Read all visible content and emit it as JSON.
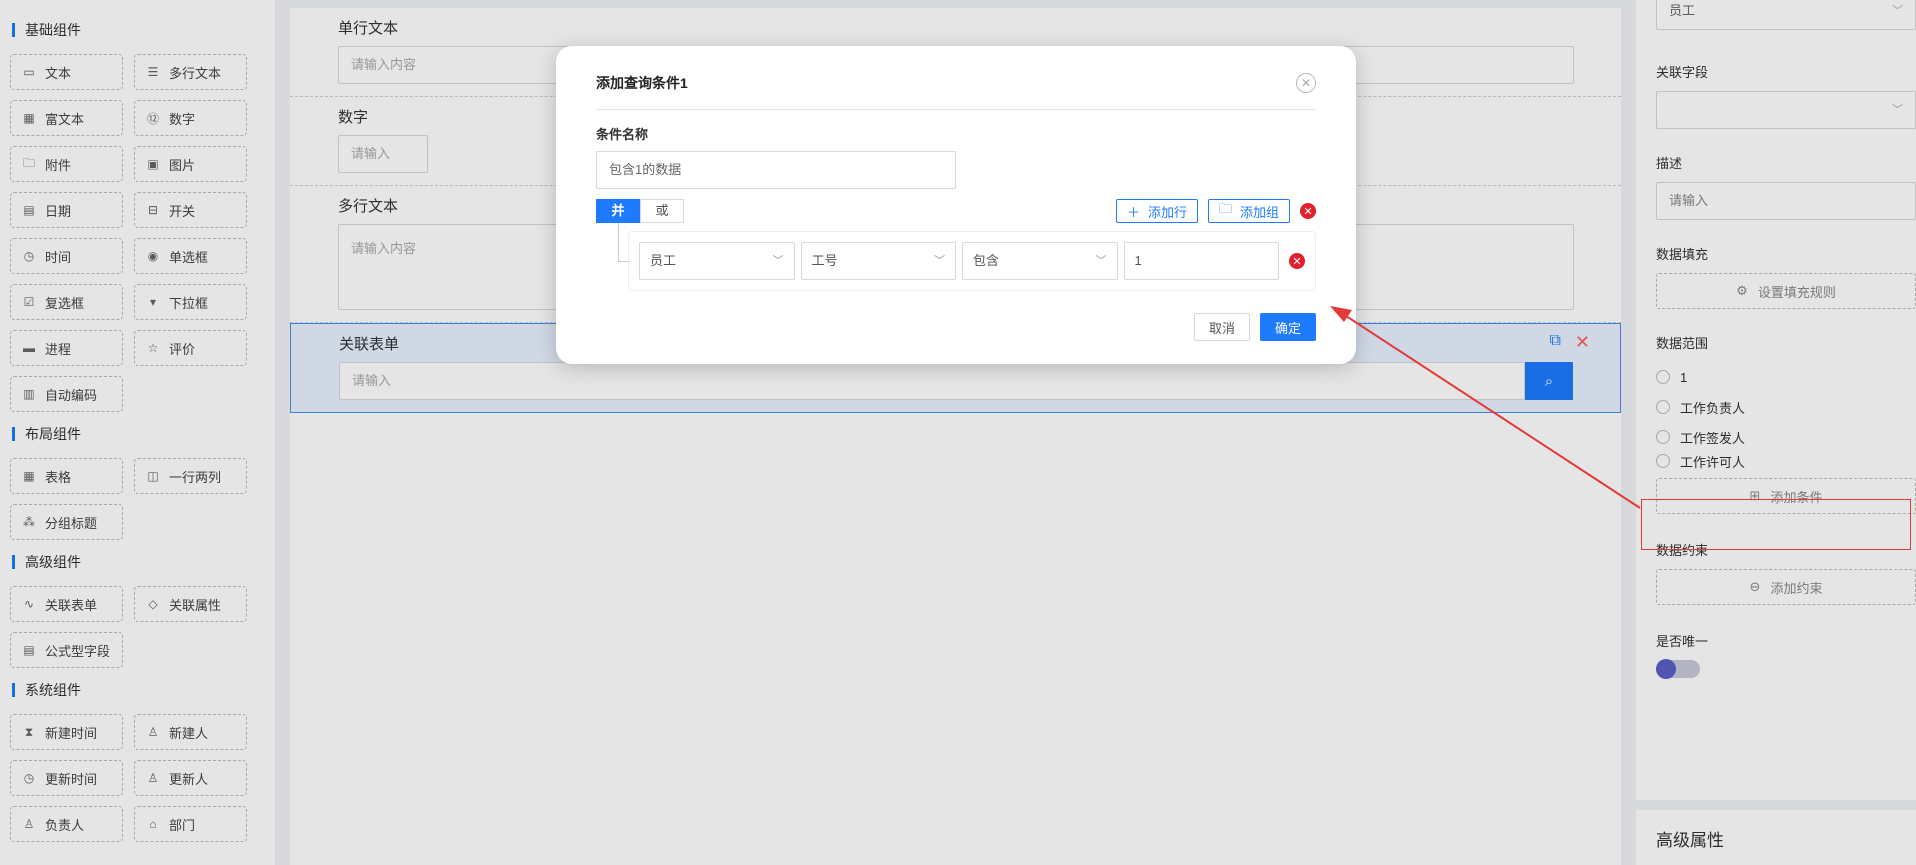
{
  "sidebar": {
    "groups": [
      {
        "title": "基础组件",
        "items": [
          {
            "label": "文本",
            "icon": "text-icon"
          },
          {
            "label": "多行文本",
            "icon": "multiline-icon"
          },
          {
            "label": "富文本",
            "icon": "richtext-icon"
          },
          {
            "label": "数字",
            "icon": "number-icon"
          },
          {
            "label": "附件",
            "icon": "folder-icon"
          },
          {
            "label": "图片",
            "icon": "image-icon"
          },
          {
            "label": "日期",
            "icon": "calendar-icon"
          },
          {
            "label": "开关",
            "icon": "switch-icon"
          },
          {
            "label": "时间",
            "icon": "clock-icon"
          },
          {
            "label": "单选框",
            "icon": "radio-icon"
          },
          {
            "label": "复选框",
            "icon": "checkbox-icon"
          },
          {
            "label": "下拉框",
            "icon": "dropdown-icon"
          },
          {
            "label": "进程",
            "icon": "progress-icon"
          },
          {
            "label": "评价",
            "icon": "star-icon"
          },
          {
            "label": "自动编码",
            "icon": "autocode-icon"
          }
        ]
      },
      {
        "title": "布局组件",
        "items": [
          {
            "label": "表格",
            "icon": "table-icon"
          },
          {
            "label": "一行两列",
            "icon": "two-column-icon"
          },
          {
            "label": "分组标题",
            "icon": "group-icon"
          }
        ]
      },
      {
        "title": "高级组件",
        "items": [
          {
            "label": "关联表单",
            "icon": "link-form-icon"
          },
          {
            "label": "关联属性",
            "icon": "tag-icon"
          },
          {
            "label": "公式型字段",
            "icon": "formula-icon"
          }
        ]
      },
      {
        "title": "系统组件",
        "items": [
          {
            "label": "新建时间",
            "icon": "hourglass-icon"
          },
          {
            "label": "新建人",
            "icon": "user-icon"
          },
          {
            "label": "更新时间",
            "icon": "clock-icon"
          },
          {
            "label": "更新人",
            "icon": "user-icon"
          },
          {
            "label": "负责人",
            "icon": "user-icon"
          },
          {
            "label": "部门",
            "icon": "department-icon"
          }
        ]
      }
    ]
  },
  "canvas": {
    "fields": [
      {
        "label": "单行文本",
        "placeholder": "请输入内容"
      },
      {
        "label": "数字",
        "placeholder": "请输入"
      },
      {
        "label": "多行文本",
        "placeholder": "请输入内容"
      },
      {
        "label": "关联表单",
        "placeholder": "请输入"
      }
    ]
  },
  "right_panel": {
    "top_select_value": "员工",
    "related_field_label": "关联字段",
    "related_field_value": "",
    "description_label": "描述",
    "description_placeholder": "请输入",
    "fill_label": "数据填充",
    "fill_button": "设置填充规则",
    "range_label": "数据范围",
    "range_options": [
      "1",
      "工作负责人",
      "工作签发人",
      "工作许可人"
    ],
    "add_condition": "添加条件",
    "constraint_label": "数据约束",
    "add_constraint": "添加约束",
    "unique_label": "是否唯一",
    "advanced_title": "高级属性"
  },
  "modal": {
    "title": "添加查询条件1",
    "name_label": "条件名称",
    "name_value": "包含1的数据",
    "logic_and": "并",
    "logic_or": "或",
    "add_row": "添加行",
    "add_group": "添加组",
    "condition": {
      "field": "员工",
      "subfield": "工号",
      "operator": "包含",
      "value": "1"
    },
    "cancel": "取消",
    "confirm": "确定"
  },
  "colors": {
    "accent": "#1e7bff",
    "danger": "#e3202d",
    "annotation": "#e53935"
  }
}
